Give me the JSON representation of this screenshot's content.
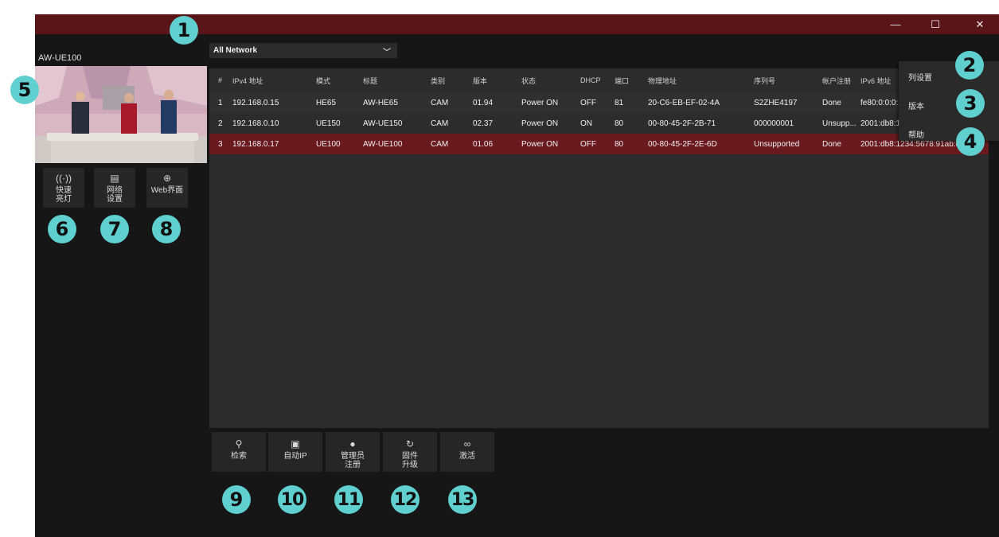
{
  "window": {
    "minimize_glyph": "—",
    "maximize_glyph": "☐",
    "close_glyph": "✕",
    "device_name": "AW-UE100"
  },
  "network_select": {
    "value": "All Network"
  },
  "side_buttons": [
    {
      "label": "快速\n亮灯",
      "icon": "signal-broadcast-icon"
    },
    {
      "label": "网络\n设置",
      "icon": "network-settings-icon"
    },
    {
      "label": "Web界面",
      "icon": "globe-icon"
    }
  ],
  "table": {
    "columns": [
      "#",
      "IPv4 地址",
      "模式",
      "标题",
      "类别",
      "版本",
      "状态",
      "DHCP",
      "端口",
      "物理地址",
      "序列号",
      "帐户注册",
      "IPv6 地址"
    ],
    "rows": [
      [
        "1",
        "192.168.0.15",
        "HE65",
        "AW-HE65",
        "CAM",
        "01.94",
        "Power ON",
        "OFF",
        "81",
        "20-C6-EB-EF-02-4A",
        "S2ZHE4197",
        "Done",
        "fe80:0:0:0:2"
      ],
      [
        "2",
        "192.168.0.10",
        "UE150",
        "AW-UE150",
        "CAM",
        "02.37",
        "Power ON",
        "ON",
        "80",
        "00-80-45-2F-2B-71",
        "000000001",
        "Unsupp...",
        "2001:db8:1"
      ],
      [
        "3",
        "192.168.0.17",
        "UE100",
        "AW-UE100",
        "CAM",
        "01.06",
        "Power ON",
        "OFF",
        "80",
        "00-80-45-2F-2E-6D",
        "Unsupported",
        "Done",
        "2001:db8:1234:5678:91ab:cdef"
      ]
    ],
    "selected_row": 3
  },
  "context_menu": {
    "items": [
      "列设置",
      "版本",
      "帮助"
    ]
  },
  "bottom_buttons": [
    {
      "label": "检索",
      "icon": "search-icon"
    },
    {
      "label": "自动IP",
      "icon": "auto-ip-icon"
    },
    {
      "label": "管理员\n注册",
      "icon": "admin-user-icon"
    },
    {
      "label": "固件\n升级",
      "icon": "firmware-update-icon"
    },
    {
      "label": "激活",
      "icon": "link-icon"
    }
  ],
  "callouts": [
    "1",
    "2",
    "3",
    "4",
    "5",
    "6",
    "7",
    "8",
    "9",
    "10",
    "11",
    "12",
    "13"
  ],
  "colors": {
    "titlebar": "#5a1518",
    "selected_row": "#6a1a1f",
    "callout": "#5fd0cf",
    "background": "#161616"
  }
}
